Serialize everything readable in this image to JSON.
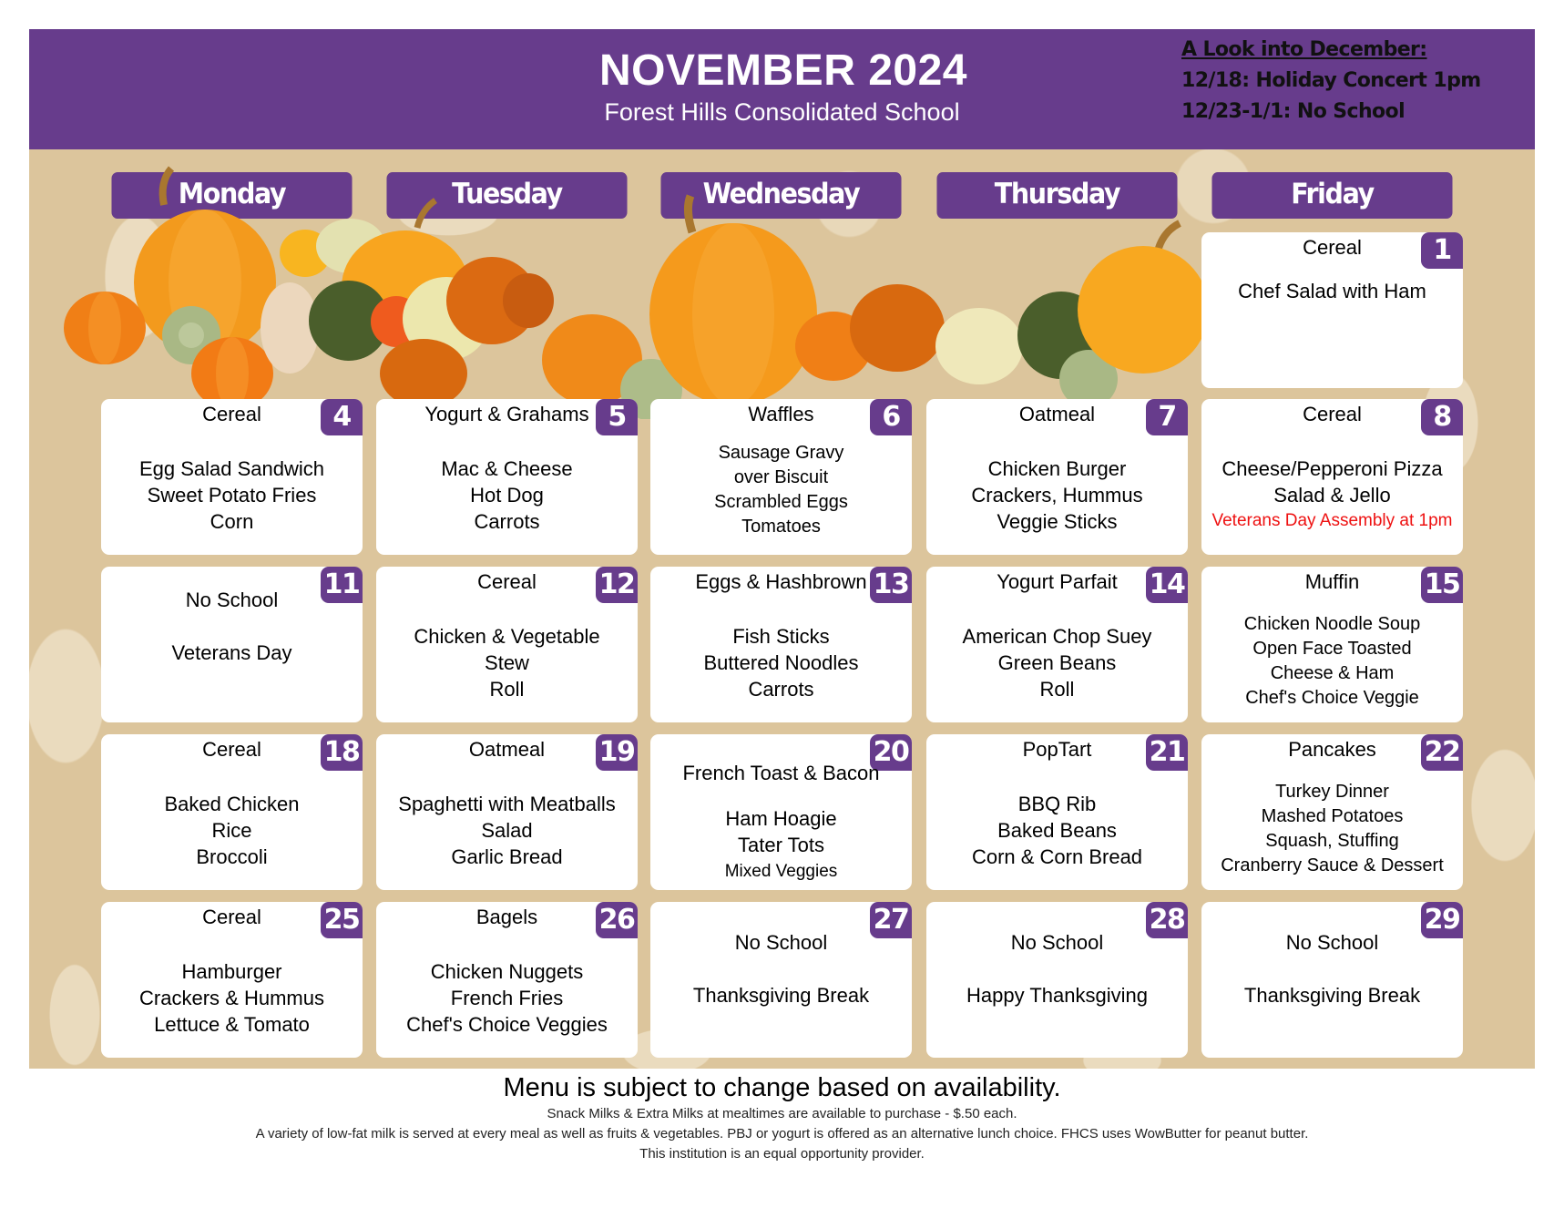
{
  "header": {
    "title": "NOVEMBER 2024",
    "subtitle": "Forest Hills Consolidated School",
    "lookahead": {
      "heading": "A Look into December:",
      "items": [
        "12/18: Holiday Concert 1pm",
        "12/23-1/1: No School"
      ]
    }
  },
  "colors": {
    "purple": "#673c8c",
    "beige": "#dcc59c",
    "note_red": "#ee1111"
  },
  "days": [
    "Monday",
    "Tuesday",
    "Wednesday",
    "Thursday",
    "Friday"
  ],
  "weeks": [
    [
      null,
      null,
      null,
      null,
      {
        "date": "1",
        "breakfast": "Cereal",
        "lunch": [
          "Chef Salad with Ham"
        ]
      }
    ],
    [
      {
        "date": "4",
        "breakfast": "Cereal",
        "lunch": [
          "Egg Salad Sandwich",
          "Sweet Potato Fries",
          "Corn"
        ]
      },
      {
        "date": "5",
        "breakfast": "Yogurt & Grahams",
        "lunch": [
          "Mac & Cheese",
          "Hot Dog",
          "Carrots"
        ]
      },
      {
        "date": "6",
        "breakfast": "Waffles",
        "lunch": [
          "Sausage Gravy",
          "over Biscuit",
          "Scrambled Eggs",
          "Tomatoes"
        ]
      },
      {
        "date": "7",
        "breakfast": "Oatmeal",
        "lunch": [
          "Chicken Burger",
          "Crackers, Hummus",
          "Veggie Sticks"
        ]
      },
      {
        "date": "8",
        "breakfast": "Cereal",
        "lunch": [
          "Cheese/Pepperoni Pizza",
          "Salad & Jello"
        ],
        "note": "Veterans Day Assembly at 1pm"
      }
    ],
    [
      {
        "date": "11",
        "breakfast": "",
        "lunch": [
          "No School",
          "",
          "Veterans Day"
        ]
      },
      {
        "date": "12",
        "breakfast": "Cereal",
        "lunch": [
          "Chicken & Vegetable",
          "Stew",
          "Roll"
        ]
      },
      {
        "date": "13",
        "breakfast": "Eggs & Hashbrown",
        "lunch": [
          "Fish Sticks",
          "Buttered Noodles",
          "Carrots"
        ]
      },
      {
        "date": "14",
        "breakfast": "Yogurt Parfait",
        "lunch": [
          "American Chop Suey",
          "Green Beans",
          "Roll"
        ]
      },
      {
        "date": "15",
        "breakfast": "Muffin",
        "lunch": [
          "Chicken Noodle Soup",
          "Open Face Toasted",
          "Cheese & Ham",
          "Chef's Choice Veggie"
        ]
      }
    ],
    [
      {
        "date": "18",
        "breakfast": "Cereal",
        "lunch": [
          "Baked Chicken",
          "Rice",
          "Broccoli"
        ]
      },
      {
        "date": "19",
        "breakfast": "Oatmeal",
        "lunch": [
          "Spaghetti with Meatballs",
          "Salad",
          "Garlic Bread"
        ]
      },
      {
        "date": "20",
        "breakfast": "French Toast & Bacon",
        "lunch": [
          "Ham Hoagie",
          "Tater Tots",
          "Mixed Veggies"
        ]
      },
      {
        "date": "21",
        "breakfast": "PopTart",
        "lunch": [
          "BBQ Rib",
          "Baked Beans",
          "Corn & Corn Bread"
        ]
      },
      {
        "date": "22",
        "breakfast": "Pancakes",
        "lunch": [
          "Turkey Dinner",
          "Mashed Potatoes",
          "Squash, Stuffing",
          "Cranberry Sauce & Dessert"
        ]
      }
    ],
    [
      {
        "date": "25",
        "breakfast": "Cereal",
        "lunch": [
          "Hamburger",
          "Crackers & Hummus",
          "Lettuce & Tomato"
        ]
      },
      {
        "date": "26",
        "breakfast": "Bagels",
        "lunch": [
          "Chicken Nuggets",
          "French Fries",
          "Chef's Choice Veggies"
        ]
      },
      {
        "date": "27",
        "breakfast": "",
        "lunch": [
          "No School",
          "",
          "Thanksgiving Break"
        ]
      },
      {
        "date": "28",
        "breakfast": "",
        "lunch": [
          "No School",
          "",
          "Happy Thanksgiving"
        ]
      },
      {
        "date": "29",
        "breakfast": "",
        "lunch": [
          "No School",
          "",
          "Thanksgiving Break"
        ]
      }
    ]
  ],
  "footer": {
    "main": "Menu is subject to change based on availability.",
    "lines": [
      "Snack Milks & Extra Milks at mealtimes are available to purchase - $.50 each.",
      "A variety of low-fat milk is served at every meal as well as fruits & vegetables.  PBJ or yogurt is offered as an alternative lunch choice.  FHCS uses WowButter for peanut butter.",
      "This institution is an equal opportunity provider."
    ]
  }
}
